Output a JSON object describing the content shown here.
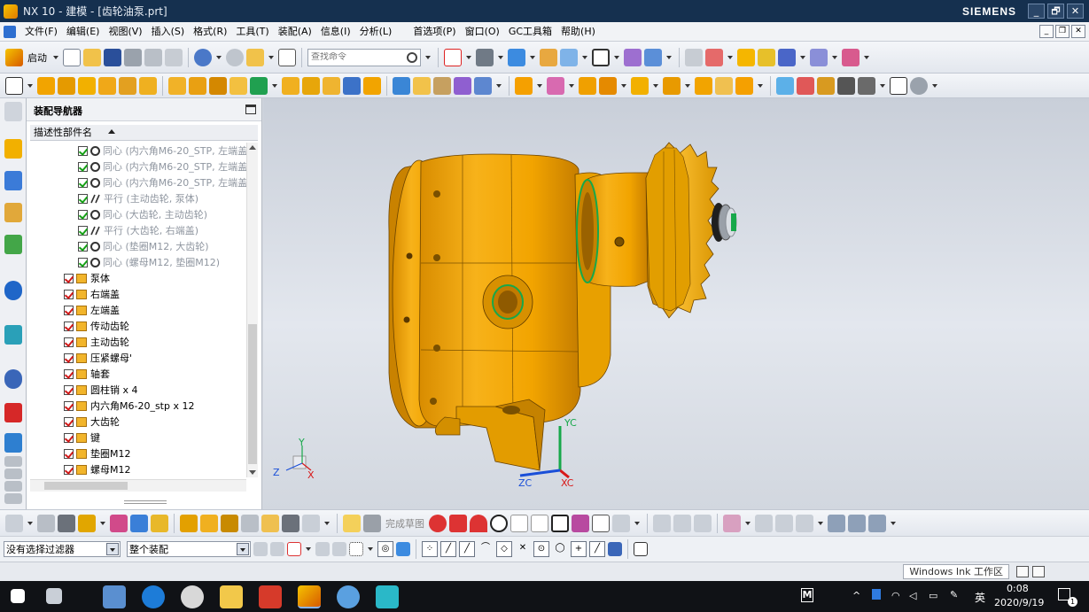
{
  "window": {
    "title": "NX 10 - 建模 - [齿轮油泵.prt]",
    "brand": "SIEMENS",
    "buttons": {
      "minimize": "_",
      "restore": "🗗",
      "close": "✕"
    }
  },
  "menubar": {
    "items": [
      "文件(F)",
      "编辑(E)",
      "视图(V)",
      "插入(S)",
      "格式(R)",
      "工具(T)",
      "装配(A)",
      "信息(I)",
      "分析(L)",
      "首选项(P)",
      "窗口(O)",
      "GC工具箱",
      "帮助(H)"
    ]
  },
  "toolbar1": {
    "start_label": "启动",
    "search_placeholder": "查找命令"
  },
  "navigator": {
    "title": "装配导航器",
    "column_header": "描述性部件名",
    "constraints": [
      {
        "type": "concentric",
        "label": "同心 (内六角M6-20_STP, 左端盖"
      },
      {
        "type": "concentric",
        "label": "同心 (内六角M6-20_STP, 左端盖"
      },
      {
        "type": "concentric",
        "label": "同心 (内六角M6-20_STP, 左端盖"
      },
      {
        "type": "parallel",
        "label": "平行 (主动齿轮, 泵体)"
      },
      {
        "type": "concentric",
        "label": "同心 (大齿轮, 主动齿轮)"
      },
      {
        "type": "parallel",
        "label": "平行 (大齿轮, 右端盖)"
      },
      {
        "type": "concentric",
        "label": "同心 (垫圈M12, 大齿轮)"
      },
      {
        "type": "concentric",
        "label": "同心 (螺母M12, 垫圈M12)"
      }
    ],
    "parts": [
      "泵体",
      "右端盖",
      "左端盖",
      "传动齿轮",
      "主动齿轮",
      "压紧螺母'",
      "轴套",
      "圆柱销 x 4",
      "内六角M6-20_stp x 12",
      "大齿轮",
      "键",
      "垫圈M12",
      "螺母M12"
    ]
  },
  "viewport": {
    "wcs": {
      "x": "X",
      "y": "Y",
      "z": "Z"
    },
    "triad": {
      "xc": "XC",
      "yc": "YC",
      "zc": "ZC"
    },
    "colors": {
      "body": "#f2a400",
      "body_dark": "#b87400",
      "gear": "#f0b21a",
      "triad_x": "#d81818",
      "triad_y": "#17a84a",
      "triad_z": "#1a4fd8"
    }
  },
  "toolbar3": {
    "sketch_label": "完成草图"
  },
  "selection": {
    "filter": "没有选择过滤器",
    "scope": "整个装配"
  },
  "statusbar": {
    "ink_label": "Windows Ink 工作区"
  },
  "taskbar": {
    "ime_m": "M",
    "lang": "英",
    "time": "0:08",
    "date": "2020/9/19",
    "notify_count": "1"
  }
}
